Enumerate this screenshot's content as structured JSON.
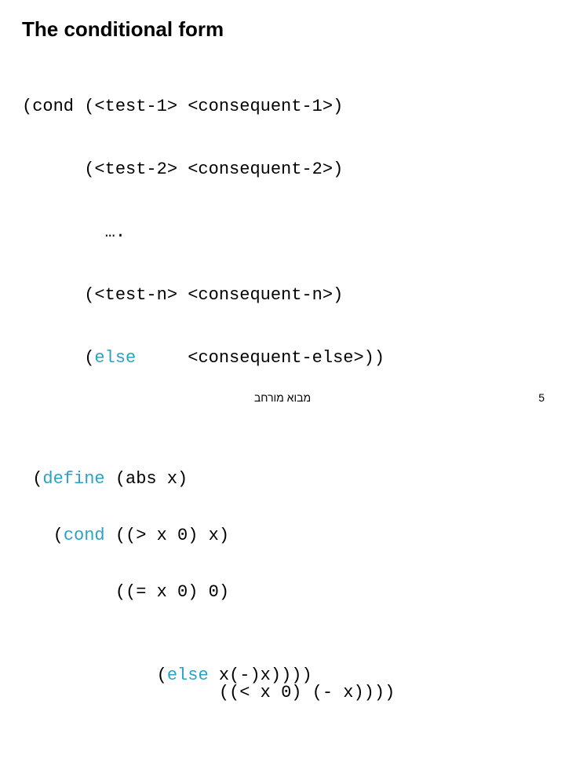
{
  "title": "The conditional form",
  "syntax": {
    "l1": "(cond (<test-1> <consequent-1>)",
    "l2": "      (<test-2> <consequent-2>)",
    "l3": "        ….",
    "l4": "      (<test-n> <consequent-n>)",
    "l5a": "      (",
    "l5b": "else",
    "l5c": "     <consequent-else>))"
  },
  "example": {
    "l1a": " (",
    "l1b": "define",
    "l1c": " (abs x)",
    "l2a": "   (",
    "l2b": "cond",
    "l2c": " ((> x ",
    "l2d": "0",
    "l2e": ") x)",
    "l3a": "         ((= x ",
    "l3b": "0",
    "l3c": ") ",
    "l3d": "0",
    "l3e": ")",
    "l4_layer1": "         ((< x 0) (- x))))",
    "l4_layer2_a": "         (",
    "l4_layer2_b": "else",
    "l4_layer2_c": " x(-)x))))"
  },
  "footer": "מבוא מורחב",
  "pagenum": "5"
}
